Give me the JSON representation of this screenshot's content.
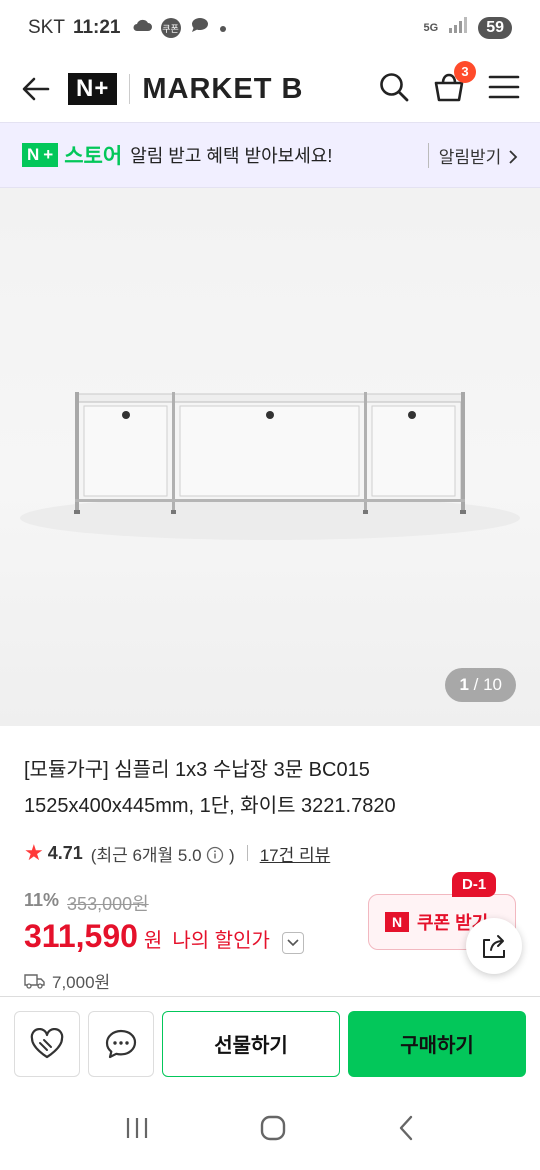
{
  "status_bar": {
    "carrier": "SKT",
    "time": "11:21",
    "coupon_badge": "쿠폰",
    "network": "5G",
    "battery": "59"
  },
  "header": {
    "logo": "N+",
    "brand": "MARKET B",
    "cart_count": "3"
  },
  "promo": {
    "logo": "N+",
    "store": "스토어",
    "message": "알림 받고 혜택 받아보세요!",
    "action": "알림받기"
  },
  "gallery": {
    "current": "1",
    "total": "/ 10"
  },
  "product": {
    "title_line1": "[모듈가구] 심플리 1x3 수납장 3문 BC015",
    "title_line2": "1525x400x445mm, 1단, 화이트 3221.7820",
    "rating": "4.71",
    "rating_meta": "(최근 6개월 5.0",
    "rating_meta_end": ")",
    "review_link": "17건 리뷰",
    "discount_pct": "11%",
    "original_price": "353,000원",
    "price": "311,590",
    "price_unit": "원",
    "my_price_label": "나의 할인가",
    "shipping": "7,000원"
  },
  "coupon": {
    "d_badge": "D-1",
    "label": "쿠폰 받기"
  },
  "bottom_bar": {
    "gift": "선물하기",
    "buy": "구매하기"
  },
  "colors": {
    "naver_green": "#03c75a",
    "price_red": "#e5112b",
    "promo_bg": "#f1efff"
  }
}
